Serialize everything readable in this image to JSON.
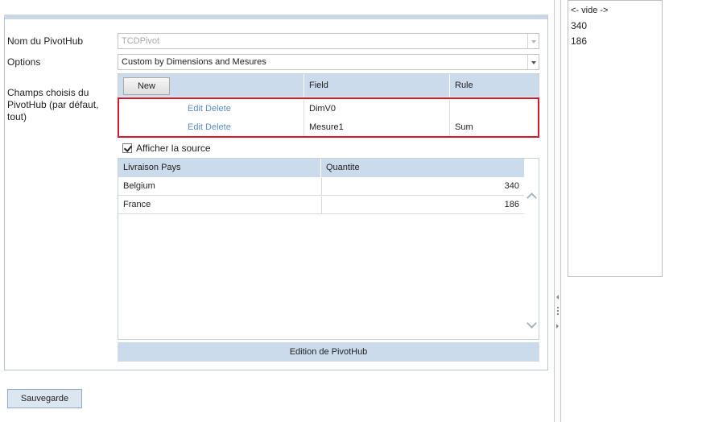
{
  "form": {
    "nom_label": "Nom du PivotHub",
    "nom_value": "TCDPivot",
    "options_label": "Options",
    "options_value": "Custom by Dimensions and Mesures",
    "champs_label_lines": [
      "Champs choisis du",
      "PivotHub (par défaut,",
      "tout)"
    ]
  },
  "fields_table": {
    "new_label": "New",
    "columns": [
      "Field",
      "Rule"
    ],
    "rows": [
      {
        "edit": "Edit",
        "delete": "Delete",
        "field": "DimV0",
        "rule": ""
      },
      {
        "edit": "Edit",
        "delete": "Delete",
        "field": "Mesure1",
        "rule": "Sum"
      }
    ]
  },
  "show_source": {
    "label": "Afficher la source",
    "checked": true
  },
  "source_table": {
    "columns": [
      "Livraison Pays",
      "Quantite"
    ],
    "rows": [
      {
        "pays": "Belgium",
        "quantite": "340"
      },
      {
        "pays": "France",
        "quantite": "186"
      }
    ]
  },
  "edition_bar": "Edition de PivotHub",
  "save_label": "Sauvegarde",
  "right_list": {
    "items": [
      "<- vide ->",
      "340",
      "186"
    ]
  },
  "colors": {
    "header_blue": "#ccdbeb",
    "link_blue": "#5b8ec7",
    "highlight_red": "#d7172b"
  }
}
